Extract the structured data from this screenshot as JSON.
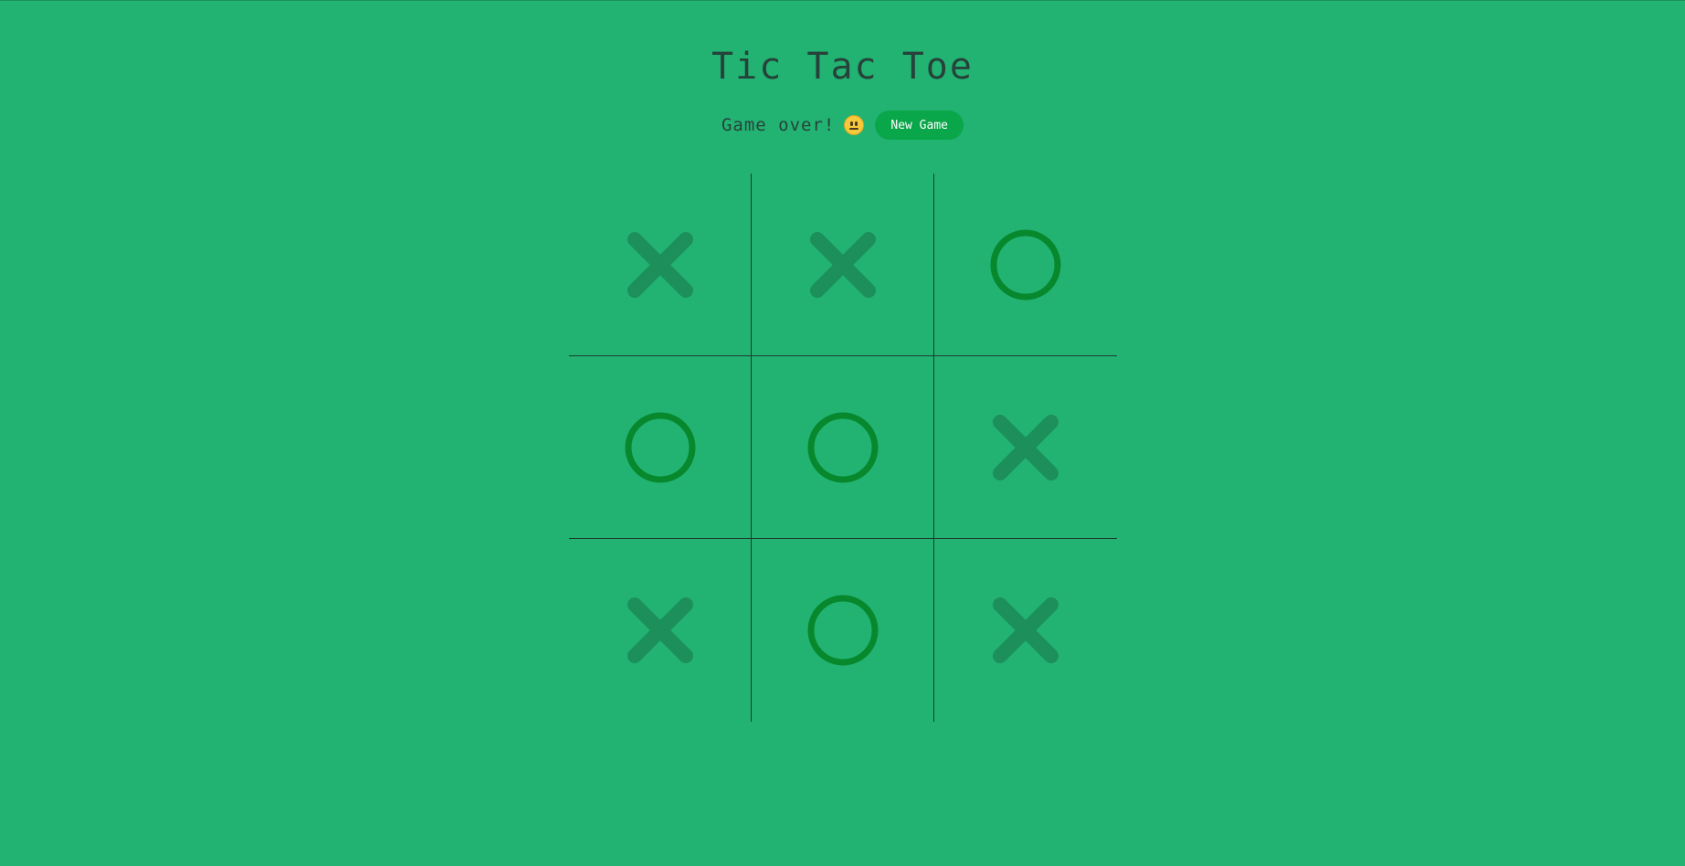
{
  "title": "Tic Tac Toe",
  "status": {
    "message": "Game over!",
    "emoji": "neutral-face-icon",
    "new_game_label": "New Game"
  },
  "board": {
    "cells": [
      [
        "X",
        "X",
        "O"
      ],
      [
        "O",
        "O",
        "X"
      ],
      [
        "X",
        "O",
        "X"
      ]
    ]
  },
  "colors": {
    "background": "#22b373",
    "x_mark": "#1c8f5b",
    "o_mark": "#07882d",
    "button": "#0aa64a",
    "grid_line": "#1d3b2e"
  }
}
